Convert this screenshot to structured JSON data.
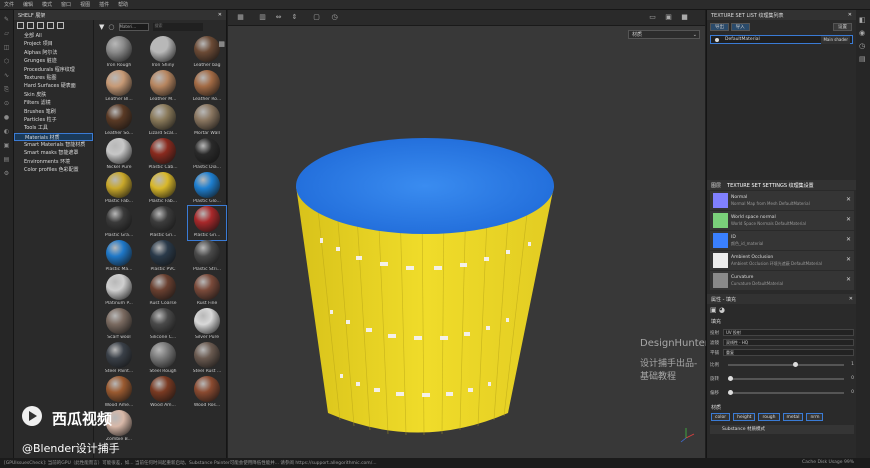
{
  "menu": [
    "文件",
    "编辑",
    "模式",
    "窗口",
    "视图",
    "插件",
    "帮助"
  ],
  "shelf": {
    "title": "SHELF 展架",
    "categories": [
      "全部 All",
      "Project 项目",
      "Alphas 阿尔法",
      "Grunges 脏迹",
      "Procedurals 程序纹理",
      "Textures 贴图",
      "Hard Surfaces 硬表面",
      "Skin 皮肤",
      "Filters 滤镜",
      "Brushes 笔刷",
      "Particles 粒子",
      "Tools 工具",
      "Materials 材质",
      "Smart Materials 智能材质",
      "Smart masks 智能遮罩",
      "Environments 环境",
      "Color profiles 色彩配置"
    ],
    "selected_index": 12,
    "filter_value": "Materi...",
    "search_placeholder": "搜索",
    "materials": [
      {
        "label": "Iron Rough",
        "color": "#8a8a8a"
      },
      {
        "label": "Iron Shiny",
        "color": "#b8b8b8"
      },
      {
        "label": "Leather bag",
        "color": "#6b4a35"
      },
      {
        "label": "Leather Bl...",
        "color": "#c79a76"
      },
      {
        "label": "Leather M...",
        "color": "#b78660"
      },
      {
        "label": "Leather Ro...",
        "color": "#a36b45"
      },
      {
        "label": "Leather So...",
        "color": "#5a3a25"
      },
      {
        "label": "Lizard Scal...",
        "color": "#8a7a5a"
      },
      {
        "label": "Mortar Wall",
        "color": "#8a7660"
      },
      {
        "label": "Nickel Pure",
        "color": "#c7c7c7"
      },
      {
        "label": "Plastic Cab...",
        "color": "#8a2a1e"
      },
      {
        "label": "Plastic Dia...",
        "color": "#2a2a2a"
      },
      {
        "label": "Plastic Fab...",
        "color": "#c9a82a"
      },
      {
        "label": "Plastic Fab...",
        "color": "#d9b82a"
      },
      {
        "label": "Plastic Glo...",
        "color": "#1e7fd0"
      },
      {
        "label": "Plastic Gra...",
        "color": "#3a3a3a"
      },
      {
        "label": "Plastic Gri...",
        "color": "#3c3c3c"
      },
      {
        "label": "Plastic Gri...",
        "color": "#a8282a"
      },
      {
        "label": "Plastic Ma...",
        "color": "#1f78c8"
      },
      {
        "label": "Plastic PVC",
        "color": "#2a3a4a"
      },
      {
        "label": "Plastic Stri...",
        "color": "#4a4a4a"
      },
      {
        "label": "Platinum P...",
        "color": "#cfcfcf"
      },
      {
        "label": "Rust Coarse",
        "color": "#6a4030"
      },
      {
        "label": "Rust Fine",
        "color": "#7a4a3a"
      },
      {
        "label": "Scarf wool",
        "color": "#7a6a60"
      },
      {
        "label": "Silicone C...",
        "color": "#4a4a4a"
      },
      {
        "label": "Silver Pure",
        "color": "#d8d8d8"
      },
      {
        "label": "Steel Paint...",
        "color": "#3a4048"
      },
      {
        "label": "Steel Rough",
        "color": "#7a7a7a"
      },
      {
        "label": "Steel Rust ...",
        "color": "#6a5a50"
      },
      {
        "label": "Wood Ame...",
        "color": "#9a5a30"
      },
      {
        "label": "Wood Am...",
        "color": "#7a3a22"
      },
      {
        "label": "Wood Ros...",
        "color": "#8a4a30"
      },
      {
        "label": "Zombie B...",
        "color": "#d8b8a8"
      }
    ],
    "selected_material": 17
  },
  "viewport": {
    "mode_dropdown": "材质",
    "watermark_en": "DesignHunter",
    "watermark_cn": "设计捕手出品-基础教程"
  },
  "overlay": {
    "brand": "西瓜视频",
    "credit": "@Blender设计捕手"
  },
  "texture_set_list": {
    "title": "TEXTURE SET LIST 纹理集列表",
    "settings_label": "设置",
    "btn1": "导出",
    "btn2": "导入",
    "item": "DefaultMaterial",
    "shader": "Main shader"
  },
  "texture_set_settings": {
    "tabs": [
      "图层",
      "TEXTURE SET SETTINGS 纹理集设置"
    ],
    "layers": [
      {
        "title": "Normal",
        "sub": "Normal Map from Mesh DefaultMaterial",
        "color": "#8080ff"
      },
      {
        "title": "World space normal",
        "sub": "World Space Normals DefaultMaterial",
        "color": "#7ad07a"
      },
      {
        "title": "ID",
        "sub": "颜色_id_material",
        "color": "#3a80ff"
      },
      {
        "title": "Ambient Occlusion",
        "sub": "Ambient Occlusion 环境光遮蔽 DefaultMaterial",
        "color": "#ededed"
      },
      {
        "title": "Curvature",
        "sub": "Curvature DefaultMaterial",
        "color": "#8a8a8a"
      }
    ]
  },
  "properties": {
    "title": "属性 - 填充",
    "section": "填充",
    "rows": [
      {
        "label": "投射",
        "value": "UV 投射"
      },
      {
        "label": "滤镜",
        "value": "双线性 · HQ"
      },
      {
        "label": "平铺",
        "value": "重复"
      }
    ],
    "sliders": [
      {
        "label": "比例",
        "value": "1"
      },
      {
        "label": "旋转",
        "value": "0"
      },
      {
        "label": "偏移",
        "value": "0"
      }
    ],
    "material_section": "材质",
    "channels": [
      "color",
      "height",
      "rough",
      "metal",
      "nrm"
    ],
    "substance_label": "Substance 材质模式"
  },
  "status": {
    "text": "[GPUIssuesCheck]: 当前的GPU（此性能而言）可能很差，如... 当前任何时间起重新启动。Substance Painter可能会使用降低性能并... 请参阅 https://support.allegorithmic.com/...",
    "right": "Cache Disk Usage 99%"
  }
}
